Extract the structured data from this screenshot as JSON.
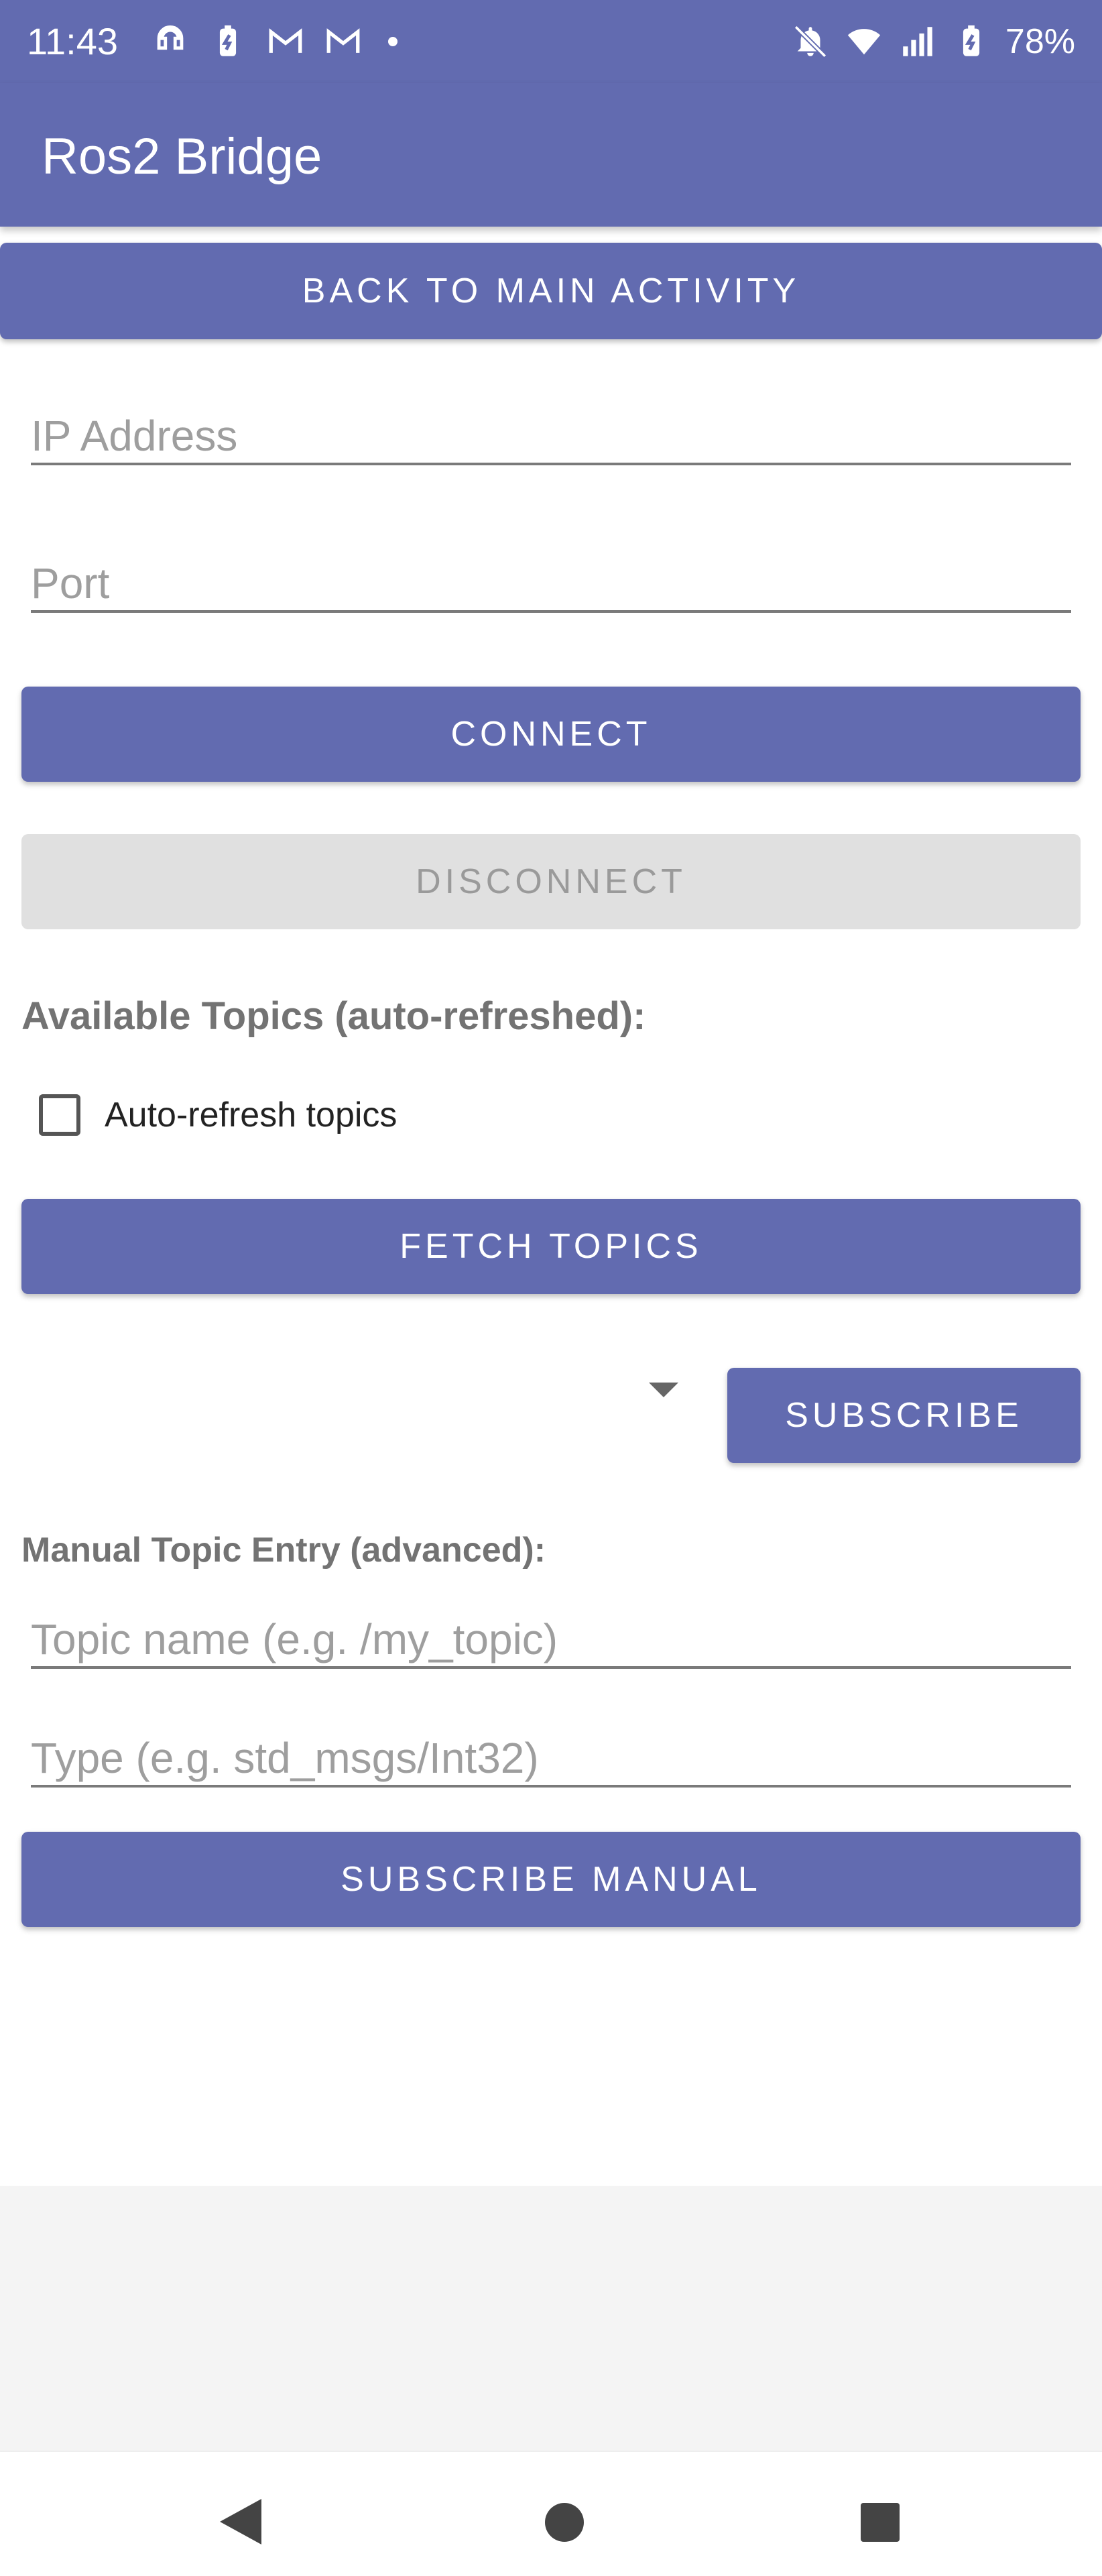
{
  "status_bar": {
    "time": "11:43",
    "battery": "78%",
    "left_icons": [
      "headset-icon",
      "battery-saver-icon",
      "gmail-icon",
      "gmail-icon",
      "dot-icon"
    ],
    "right_icons": [
      "notifications-off-icon",
      "wifi-icon",
      "cell-signal-icon",
      "battery-charging-icon"
    ]
  },
  "app_bar": {
    "title": "Ros2 Bridge"
  },
  "buttons": {
    "back_to_main": "BACK TO MAIN ACTIVITY",
    "connect": "CONNECT",
    "disconnect": "DISCONNECT",
    "fetch_topics": "FETCH TOPICS",
    "subscribe": "SUBSCRIBE",
    "subscribe_manual": "SUBSCRIBE MANUAL"
  },
  "fields": {
    "ip_address": {
      "placeholder": "IP Address",
      "value": ""
    },
    "port": {
      "placeholder": "Port",
      "value": ""
    },
    "topic_name": {
      "placeholder": "Topic name (e.g. /my_topic)",
      "value": ""
    },
    "type": {
      "placeholder": "Type (e.g. std_msgs/Int32)",
      "value": ""
    }
  },
  "labels": {
    "available_topics": "Available Topics (auto-refreshed):",
    "manual_entry": "Manual Topic Entry (advanced):"
  },
  "checkbox": {
    "label": "Auto-refresh topics",
    "checked": false
  },
  "spinner": {
    "selected": ""
  },
  "nav_bar": [
    "back-icon",
    "home-icon",
    "recents-icon"
  ],
  "colors": {
    "primary": "#626bb0",
    "disabled_bg": "#e0e0e0",
    "disabled_text": "#9a9a9a"
  }
}
